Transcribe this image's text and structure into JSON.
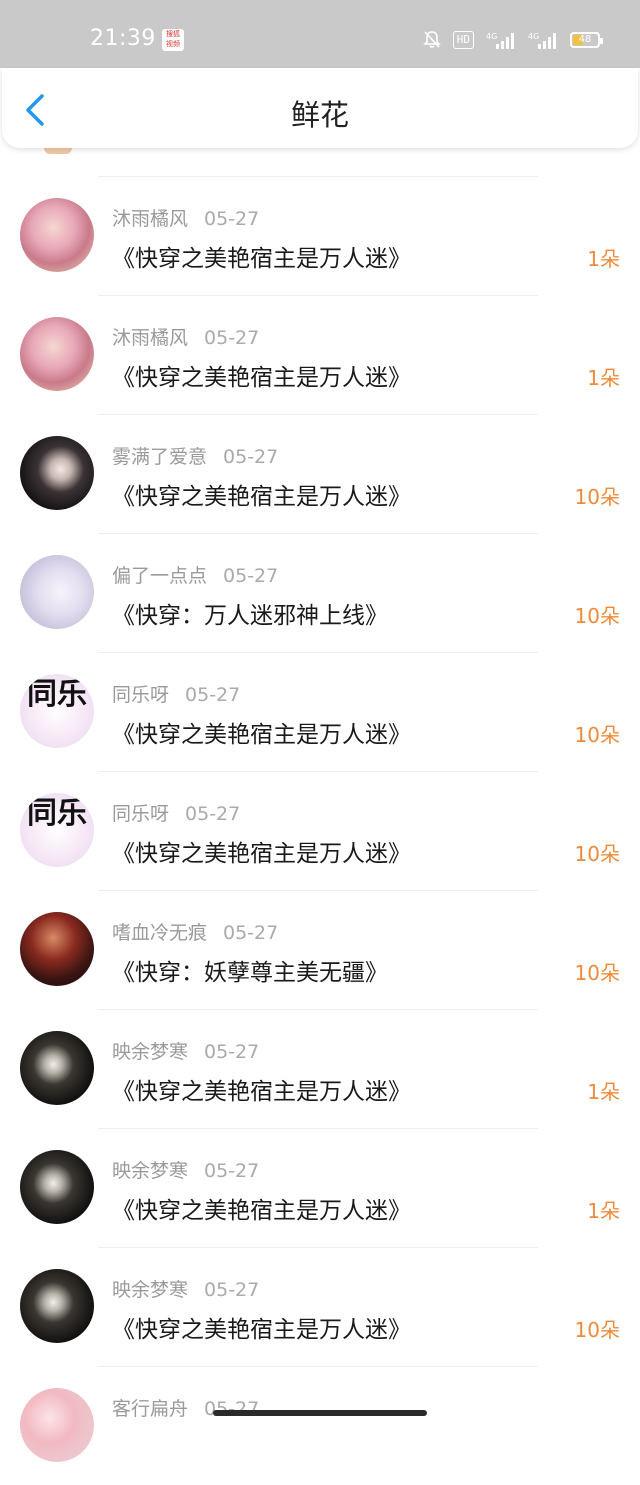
{
  "status_bar": {
    "time": "21:39",
    "app_icon_lines": [
      "搜狐",
      "视频"
    ],
    "hd_label": "HD",
    "net_1": "4G",
    "net_2": "4G",
    "battery": "48",
    "battery_level": 0.48
  },
  "header": {
    "title": "鲜花",
    "back_icon": "chevron-left-icon",
    "accent_color": "#2196f3"
  },
  "accent_colors": {
    "flower_count": "#f08a3a",
    "meta_text": "#9a9a9a"
  },
  "rows": [
    {
      "user": "沐雨橘风",
      "date": "05-27",
      "book": "《快穿之美艳宿主是万人迷》",
      "flowers": "1朵"
    },
    {
      "user": "沐雨橘风",
      "date": "05-27",
      "book": "《快穿之美艳宿主是万人迷》",
      "flowers": "1朵"
    },
    {
      "user": "雾满了爱意",
      "date": "05-27",
      "book": "《快穿之美艳宿主是万人迷》",
      "flowers": "10朵"
    },
    {
      "user": "偏了一点点",
      "date": "05-27",
      "book": "《快穿：万人迷邪神上线》",
      "flowers": "10朵"
    },
    {
      "user": "同乐呀",
      "date": "05-27",
      "book": "《快穿之美艳宿主是万人迷》",
      "flowers": "10朵"
    },
    {
      "user": "同乐呀",
      "date": "05-27",
      "book": "《快穿之美艳宿主是万人迷》",
      "flowers": "10朵"
    },
    {
      "user": "嗜血冷无痕",
      "date": "05-27",
      "book": "《快穿：妖孽尊主美无疆》",
      "flowers": "10朵"
    },
    {
      "user": "映余梦寒",
      "date": "05-27",
      "book": "《快穿之美艳宿主是万人迷》",
      "flowers": "1朵"
    },
    {
      "user": "映余梦寒",
      "date": "05-27",
      "book": "《快穿之美艳宿主是万人迷》",
      "flowers": "1朵"
    },
    {
      "user": "映余梦寒",
      "date": "05-27",
      "book": "《快穿之美艳宿主是万人迷》",
      "flowers": "10朵"
    },
    {
      "user": "客行扁舟",
      "date": "05-27",
      "book": "",
      "flowers": ""
    }
  ],
  "avatar_glyphs": {
    "tongle": "同乐"
  }
}
